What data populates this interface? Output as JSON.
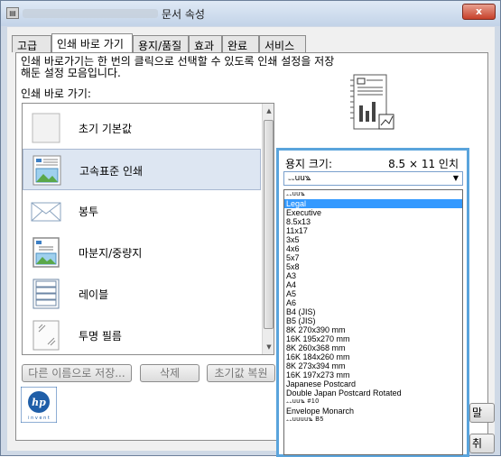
{
  "window": {
    "title": "문서 속성",
    "close_label": "x"
  },
  "tabs": [
    {
      "label": "고급"
    },
    {
      "label": "인쇄 바로 가기"
    },
    {
      "label": "용지/품질"
    },
    {
      "label": "효과"
    },
    {
      "label": "완료"
    },
    {
      "label": "서비스"
    }
  ],
  "shortcuts": {
    "description": "인쇄 바로가기는 한 번의 클릭으로 선택할 수 있도록 인쇄 설정을 저장\n해둔 설정 모음입니다.",
    "list_label": "인쇄 바로 가기:",
    "items": [
      {
        "label": "초기 기본값",
        "icon": "blank-page-icon"
      },
      {
        "label": "고속표준 인쇄",
        "icon": "document-landscape-icon"
      },
      {
        "label": "봉투",
        "icon": "envelope-icon"
      },
      {
        "label": "마분지/중량지",
        "icon": "cardstock-icon"
      },
      {
        "label": "레이블",
        "icon": "labels-icon"
      },
      {
        "label": "투명 필름",
        "icon": "transparency-icon"
      }
    ],
    "buttons": {
      "save_as": "다른 이름으로 저장...",
      "delete": "삭제",
      "reset": "초기값 복원"
    }
  },
  "paper_size": {
    "label": "용지 크기:",
    "value": "8.5 × 11 인치",
    "selected": "ಀಀuu꧉",
    "options": [
      {
        "label": "ಀಀuu꧉",
        "garbled": true
      },
      {
        "label": "Legal",
        "highlighted": true
      },
      {
        "label": "Executive"
      },
      {
        "label": "8.5x13"
      },
      {
        "label": "11x17"
      },
      {
        "label": "3x5"
      },
      {
        "label": "4x6"
      },
      {
        "label": "5x7"
      },
      {
        "label": "5x8"
      },
      {
        "label": "A3"
      },
      {
        "label": "A4"
      },
      {
        "label": "A5"
      },
      {
        "label": "A6"
      },
      {
        "label": "B4 (JIS)"
      },
      {
        "label": "B5 (JIS)"
      },
      {
        "label": "8K 270x390 mm"
      },
      {
        "label": "16K 195x270 mm"
      },
      {
        "label": "8K 260x368 mm"
      },
      {
        "label": "16K 184x260 mm"
      },
      {
        "label": "8K 273x394 mm"
      },
      {
        "label": "16K 197x273 mm"
      },
      {
        "label": "Japanese Postcard"
      },
      {
        "label": "Double Japan Postcard Rotated"
      },
      {
        "label": "ಀಀuu꧉ #10",
        "garbled": true
      },
      {
        "label": "Envelope Monarch"
      },
      {
        "label": "ಀಀuuuu꧉ B5",
        "garbled": true
      }
    ]
  },
  "peek_buttons": {
    "right_button_1": "말",
    "right_button_2": "취"
  },
  "colors": {
    "accent": "#5aa4dc",
    "highlight": "#3399ff",
    "selected_row": "#dde6f2"
  }
}
